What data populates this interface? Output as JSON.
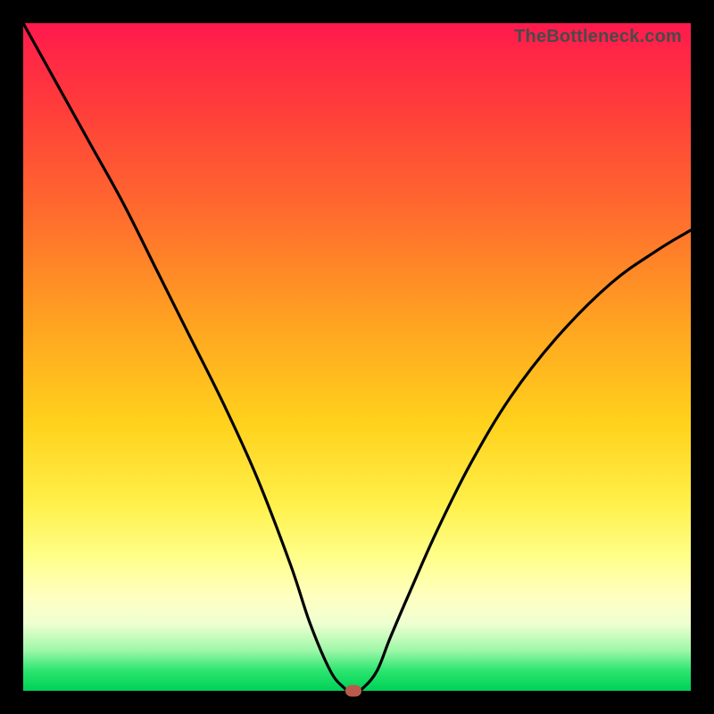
{
  "watermark": "TheBottleneck.com",
  "colors": {
    "frame": "#000000",
    "curve": "#000000",
    "marker": "#b95a4c"
  },
  "chart_data": {
    "type": "line",
    "title": "",
    "xlabel": "",
    "ylabel": "",
    "xlim": [
      0,
      100
    ],
    "ylim": [
      0,
      100
    ],
    "series": [
      {
        "name": "bottleneck-curve",
        "x": [
          0,
          5,
          10,
          15,
          20,
          25,
          30,
          35,
          40,
          43,
          46,
          48,
          49,
          50,
          51,
          53,
          55,
          58,
          62,
          67,
          73,
          80,
          88,
          95,
          100
        ],
        "values": [
          100,
          91,
          82,
          73,
          63,
          53,
          43,
          32,
          19,
          10,
          3,
          0.5,
          0,
          0,
          0.5,
          3,
          8,
          15,
          24,
          34,
          44,
          53,
          61,
          66,
          69
        ]
      }
    ],
    "marker": {
      "x": 49.5,
      "y": 0
    },
    "gradient_stops": [
      {
        "pct": 0,
        "color": "#ff1a4d"
      },
      {
        "pct": 60,
        "color": "#ffd21c"
      },
      {
        "pct": 100,
        "color": "#00d057"
      }
    ]
  }
}
